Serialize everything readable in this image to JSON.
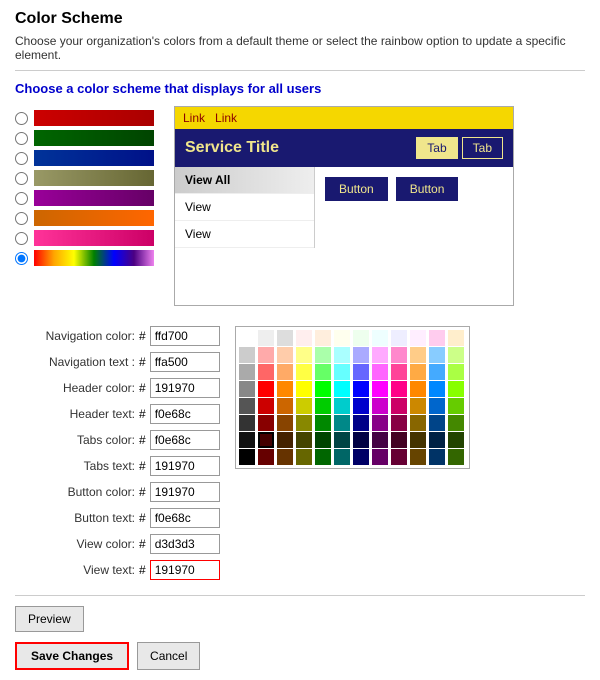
{
  "page": {
    "title": "Color Scheme",
    "description": "Choose your organization's colors from a default theme or select the rainbow option to update a specific element.",
    "subtitle": "Choose a color scheme that displays for all users"
  },
  "swatches": [
    {
      "id": 0,
      "colors": [
        "#cc0000",
        "#cc0000",
        "#cc0000"
      ],
      "gradient": "linear-gradient(to right, #cc0000, #aa0000)",
      "selected": false
    },
    {
      "id": 1,
      "colors": [
        "#006600",
        "#006600"
      ],
      "gradient": "linear-gradient(to right, #006600, #004400)",
      "selected": false
    },
    {
      "id": 2,
      "colors": [
        "#003399",
        "#003399"
      ],
      "gradient": "linear-gradient(to right, #003399, #001188)",
      "selected": false
    },
    {
      "id": 3,
      "colors": [
        "#999966",
        "#666633"
      ],
      "gradient": "linear-gradient(to right, #999966, #666633)",
      "selected": false
    },
    {
      "id": 4,
      "colors": [
        "#990099",
        "#660066"
      ],
      "gradient": "linear-gradient(to right, #990099, #660066)",
      "selected": false
    },
    {
      "id": 5,
      "colors": [
        "#cc6600",
        "#ff6600"
      ],
      "gradient": "linear-gradient(to right, #cc6600, #ff6600)",
      "selected": false
    },
    {
      "id": 6,
      "colors": [
        "#ff3399",
        "#cc0066"
      ],
      "gradient": "linear-gradient(to right, #ff3399, #cc0066)",
      "selected": false
    },
    {
      "id": 7,
      "colors": [],
      "gradient": "linear-gradient(to right, red, orange, yellow, green, blue, indigo, violet)",
      "selected": true
    }
  ],
  "preview": {
    "link1": "Link",
    "link2": "Link",
    "service_title": "Service Title",
    "tab1": "Tab",
    "tab2": "Tab",
    "nav_item1": "View All",
    "nav_item2": "View",
    "nav_item3": "View",
    "button1": "Button",
    "button2": "Button"
  },
  "fields": [
    {
      "label": "Navigation color:",
      "key": "nav_color",
      "value": "ffd700",
      "highlighted": false
    },
    {
      "label": "Navigation text :",
      "key": "nav_text",
      "value": "ffa500",
      "highlighted": false
    },
    {
      "label": "Header color:",
      "key": "header_color",
      "value": "191970",
      "highlighted": false
    },
    {
      "label": "Header text:",
      "key": "header_text",
      "value": "f0e68c",
      "highlighted": false
    },
    {
      "label": "Tabs color:",
      "key": "tabs_color",
      "value": "f0e68c",
      "highlighted": false
    },
    {
      "label": "Tabs text:",
      "key": "tabs_text",
      "value": "191970",
      "highlighted": false
    },
    {
      "label": "Button color:",
      "key": "button_color",
      "value": "191970",
      "highlighted": false
    },
    {
      "label": "Button text:",
      "key": "button_text",
      "value": "f0e68c",
      "highlighted": false
    },
    {
      "label": "View color:",
      "key": "view_color",
      "value": "d3d3d3",
      "highlighted": false
    },
    {
      "label": "View text:",
      "key": "view_text",
      "value": "191970",
      "highlighted": true
    }
  ],
  "buttons": {
    "preview": "Preview",
    "save": "Save Changes",
    "cancel": "Cancel"
  },
  "palette": {
    "colors": [
      "#ffffff",
      "#eeeeee",
      "#dddddd",
      "#ffeeee",
      "#ffeedd",
      "#ffffee",
      "#eeffee",
      "#eeffff",
      "#eeeeff",
      "#ffeeff",
      "#ffccee",
      "#ffeecc",
      "#cccccc",
      "#ffaaaa",
      "#ffccaa",
      "#ffff88",
      "#aaffaa",
      "#aaffff",
      "#aaaaff",
      "#ffaaff",
      "#ff88cc",
      "#ffcc88",
      "#88ccff",
      "#ccff88",
      "#aaaaaa",
      "#ff6666",
      "#ffaa66",
      "#ffff44",
      "#66ff66",
      "#66ffff",
      "#6666ff",
      "#ff66ff",
      "#ff4499",
      "#ffaa44",
      "#44aaff",
      "#aaff44",
      "#888888",
      "#ff0000",
      "#ff8800",
      "#ffff00",
      "#00ff00",
      "#00ffff",
      "#0000ff",
      "#ff00ff",
      "#ff0088",
      "#ff8800",
      "#0088ff",
      "#88ff00",
      "#555555",
      "#cc0000",
      "#cc6600",
      "#cccc00",
      "#00cc00",
      "#00cccc",
      "#0000cc",
      "#cc00cc",
      "#cc0066",
      "#cc8800",
      "#0066cc",
      "#66cc00",
      "#333333",
      "#880000",
      "#884400",
      "#888800",
      "#008800",
      "#008888",
      "#000088",
      "#880088",
      "#880044",
      "#886600",
      "#004488",
      "#448800",
      "#111111",
      "#440000",
      "#442200",
      "#444400",
      "#004400",
      "#004444",
      "#000044",
      "#440044",
      "#440022",
      "#443300",
      "#002244",
      "#224400",
      "#000000",
      "#660000",
      "#663300",
      "#666600",
      "#006600",
      "#006666",
      "#000066",
      "#660066",
      "#660033",
      "#664400",
      "#003366",
      "#336600"
    ],
    "selected_index": 73
  }
}
